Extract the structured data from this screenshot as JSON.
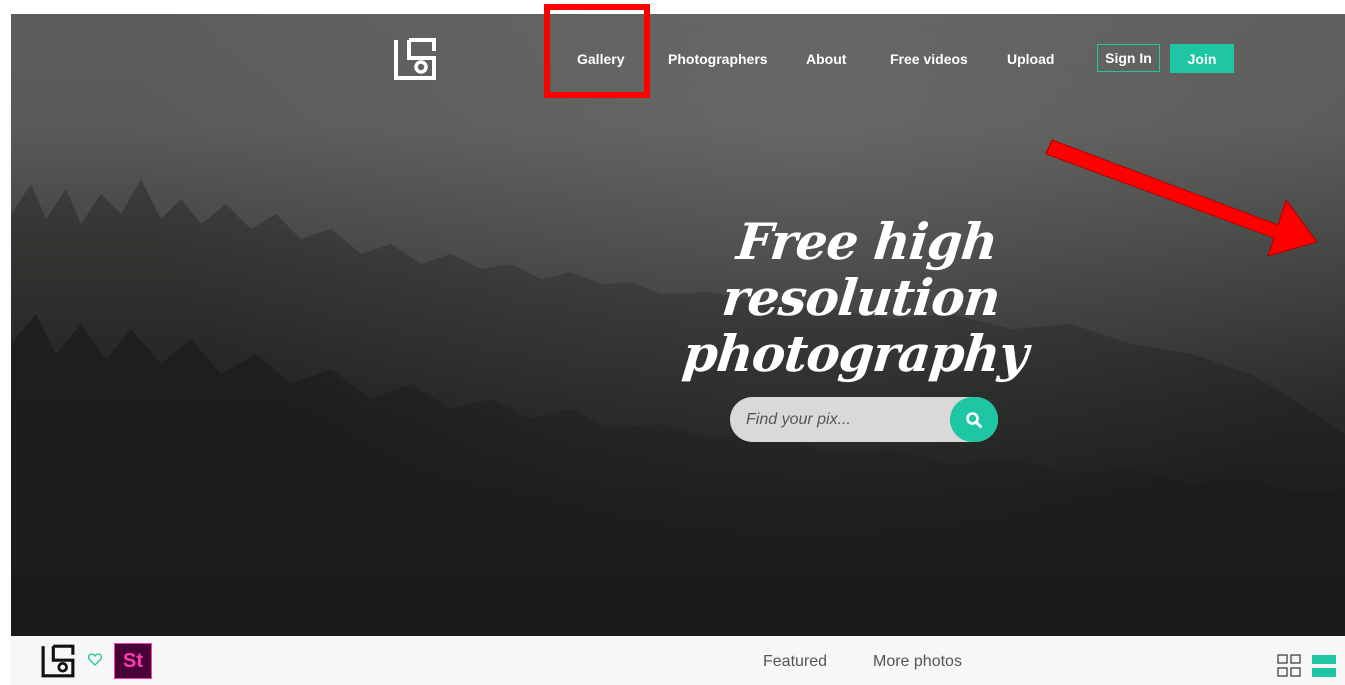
{
  "nav": {
    "logo_icon": "stocksnap-logo-icon",
    "items": [
      {
        "label": "Gallery"
      },
      {
        "label": "Photographers"
      },
      {
        "label": "About"
      },
      {
        "label": "Free videos"
      },
      {
        "label": "Upload"
      }
    ],
    "sign_in_label": "Sign In",
    "join_label": "Join"
  },
  "hero": {
    "headline_line1": "Free high resolution",
    "headline_line2": "photography"
  },
  "search": {
    "placeholder": "Find your pix...",
    "button_icon": "search-icon"
  },
  "bottom_bar": {
    "tabs": [
      {
        "label": "Featured"
      },
      {
        "label": "More photos"
      }
    ],
    "icons": [
      "stocksnap-logo-icon",
      "heart-icon",
      "adobe-stock-icon",
      "grid-view-icon",
      "list-view-icon"
    ],
    "adobe_stock_label": "St"
  },
  "annotations": {
    "highlight_color": "#ff0000"
  },
  "colors": {
    "accent": "#1fc6a4",
    "adobe_stock_bg": "#470137",
    "adobe_stock_fg": "#ff3bb0"
  }
}
